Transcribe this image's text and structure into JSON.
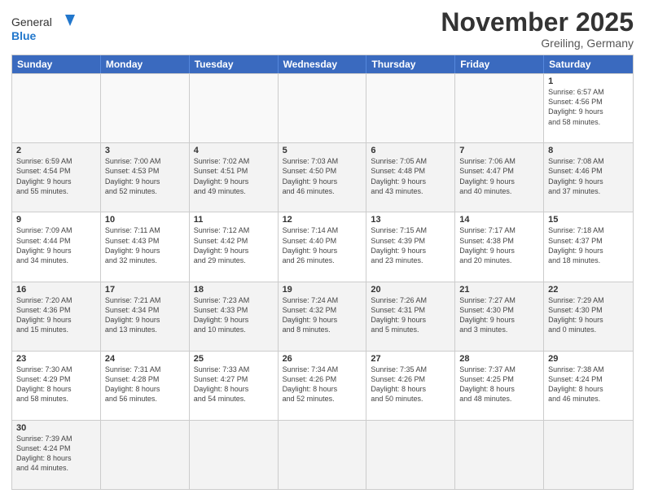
{
  "header": {
    "logo_general": "General",
    "logo_blue": "Blue",
    "month": "November 2025",
    "location": "Greiling, Germany"
  },
  "days_of_week": [
    "Sunday",
    "Monday",
    "Tuesday",
    "Wednesday",
    "Thursday",
    "Friday",
    "Saturday"
  ],
  "weeks": [
    [
      {
        "day": "",
        "info": ""
      },
      {
        "day": "",
        "info": ""
      },
      {
        "day": "",
        "info": ""
      },
      {
        "day": "",
        "info": ""
      },
      {
        "day": "",
        "info": ""
      },
      {
        "day": "",
        "info": ""
      },
      {
        "day": "1",
        "info": "Sunrise: 6:57 AM\nSunset: 4:56 PM\nDaylight: 9 hours\nand 58 minutes."
      }
    ],
    [
      {
        "day": "2",
        "info": "Sunrise: 6:59 AM\nSunset: 4:54 PM\nDaylight: 9 hours\nand 55 minutes."
      },
      {
        "day": "3",
        "info": "Sunrise: 7:00 AM\nSunset: 4:53 PM\nDaylight: 9 hours\nand 52 minutes."
      },
      {
        "day": "4",
        "info": "Sunrise: 7:02 AM\nSunset: 4:51 PM\nDaylight: 9 hours\nand 49 minutes."
      },
      {
        "day": "5",
        "info": "Sunrise: 7:03 AM\nSunset: 4:50 PM\nDaylight: 9 hours\nand 46 minutes."
      },
      {
        "day": "6",
        "info": "Sunrise: 7:05 AM\nSunset: 4:48 PM\nDaylight: 9 hours\nand 43 minutes."
      },
      {
        "day": "7",
        "info": "Sunrise: 7:06 AM\nSunset: 4:47 PM\nDaylight: 9 hours\nand 40 minutes."
      },
      {
        "day": "8",
        "info": "Sunrise: 7:08 AM\nSunset: 4:46 PM\nDaylight: 9 hours\nand 37 minutes."
      }
    ],
    [
      {
        "day": "9",
        "info": "Sunrise: 7:09 AM\nSunset: 4:44 PM\nDaylight: 9 hours\nand 34 minutes."
      },
      {
        "day": "10",
        "info": "Sunrise: 7:11 AM\nSunset: 4:43 PM\nDaylight: 9 hours\nand 32 minutes."
      },
      {
        "day": "11",
        "info": "Sunrise: 7:12 AM\nSunset: 4:42 PM\nDaylight: 9 hours\nand 29 minutes."
      },
      {
        "day": "12",
        "info": "Sunrise: 7:14 AM\nSunset: 4:40 PM\nDaylight: 9 hours\nand 26 minutes."
      },
      {
        "day": "13",
        "info": "Sunrise: 7:15 AM\nSunset: 4:39 PM\nDaylight: 9 hours\nand 23 minutes."
      },
      {
        "day": "14",
        "info": "Sunrise: 7:17 AM\nSunset: 4:38 PM\nDaylight: 9 hours\nand 20 minutes."
      },
      {
        "day": "15",
        "info": "Sunrise: 7:18 AM\nSunset: 4:37 PM\nDaylight: 9 hours\nand 18 minutes."
      }
    ],
    [
      {
        "day": "16",
        "info": "Sunrise: 7:20 AM\nSunset: 4:36 PM\nDaylight: 9 hours\nand 15 minutes."
      },
      {
        "day": "17",
        "info": "Sunrise: 7:21 AM\nSunset: 4:34 PM\nDaylight: 9 hours\nand 13 minutes."
      },
      {
        "day": "18",
        "info": "Sunrise: 7:23 AM\nSunset: 4:33 PM\nDaylight: 9 hours\nand 10 minutes."
      },
      {
        "day": "19",
        "info": "Sunrise: 7:24 AM\nSunset: 4:32 PM\nDaylight: 9 hours\nand 8 minutes."
      },
      {
        "day": "20",
        "info": "Sunrise: 7:26 AM\nSunset: 4:31 PM\nDaylight: 9 hours\nand 5 minutes."
      },
      {
        "day": "21",
        "info": "Sunrise: 7:27 AM\nSunset: 4:30 PM\nDaylight: 9 hours\nand 3 minutes."
      },
      {
        "day": "22",
        "info": "Sunrise: 7:29 AM\nSunset: 4:30 PM\nDaylight: 9 hours\nand 0 minutes."
      }
    ],
    [
      {
        "day": "23",
        "info": "Sunrise: 7:30 AM\nSunset: 4:29 PM\nDaylight: 8 hours\nand 58 minutes."
      },
      {
        "day": "24",
        "info": "Sunrise: 7:31 AM\nSunset: 4:28 PM\nDaylight: 8 hours\nand 56 minutes."
      },
      {
        "day": "25",
        "info": "Sunrise: 7:33 AM\nSunset: 4:27 PM\nDaylight: 8 hours\nand 54 minutes."
      },
      {
        "day": "26",
        "info": "Sunrise: 7:34 AM\nSunset: 4:26 PM\nDaylight: 8 hours\nand 52 minutes."
      },
      {
        "day": "27",
        "info": "Sunrise: 7:35 AM\nSunset: 4:26 PM\nDaylight: 8 hours\nand 50 minutes."
      },
      {
        "day": "28",
        "info": "Sunrise: 7:37 AM\nSunset: 4:25 PM\nDaylight: 8 hours\nand 48 minutes."
      },
      {
        "day": "29",
        "info": "Sunrise: 7:38 AM\nSunset: 4:24 PM\nDaylight: 8 hours\nand 46 minutes."
      }
    ],
    [
      {
        "day": "30",
        "info": "Sunrise: 7:39 AM\nSunset: 4:24 PM\nDaylight: 8 hours\nand 44 minutes."
      },
      {
        "day": "",
        "info": ""
      },
      {
        "day": "",
        "info": ""
      },
      {
        "day": "",
        "info": ""
      },
      {
        "day": "",
        "info": ""
      },
      {
        "day": "",
        "info": ""
      },
      {
        "day": "",
        "info": ""
      }
    ]
  ]
}
